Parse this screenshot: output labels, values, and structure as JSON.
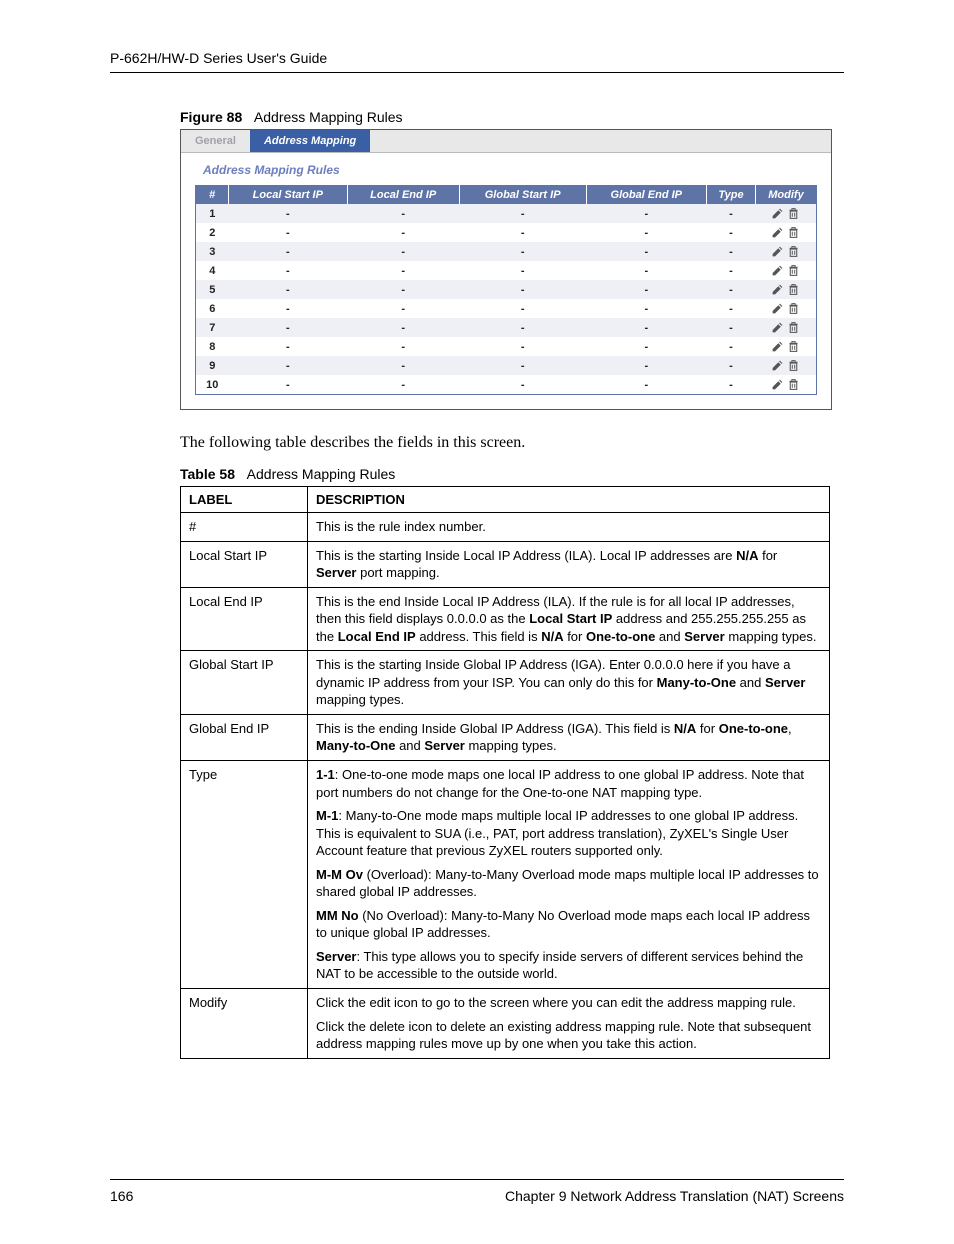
{
  "header_guide": "P-662H/HW-D Series User's Guide",
  "figure_caption_num": "Figure 88",
  "figure_caption_text": "Address Mapping Rules",
  "tabs": {
    "general": "General",
    "addrmap": "Address Mapping"
  },
  "panel_title": "Address Mapping Rules",
  "grid": {
    "headers": {
      "num": "#",
      "lstart": "Local Start IP",
      "lend": "Local End IP",
      "gstart": "Global Start IP",
      "gend": "Global End IP",
      "type": "Type",
      "modify": "Modify"
    },
    "rows": [
      {
        "n": "1",
        "ls": "-",
        "le": "-",
        "gs": "-",
        "ge": "-",
        "t": "-"
      },
      {
        "n": "2",
        "ls": "-",
        "le": "-",
        "gs": "-",
        "ge": "-",
        "t": "-"
      },
      {
        "n": "3",
        "ls": "-",
        "le": "-",
        "gs": "-",
        "ge": "-",
        "t": "-"
      },
      {
        "n": "4",
        "ls": "-",
        "le": "-",
        "gs": "-",
        "ge": "-",
        "t": "-"
      },
      {
        "n": "5",
        "ls": "-",
        "le": "-",
        "gs": "-",
        "ge": "-",
        "t": "-"
      },
      {
        "n": "6",
        "ls": "-",
        "le": "-",
        "gs": "-",
        "ge": "-",
        "t": "-"
      },
      {
        "n": "7",
        "ls": "-",
        "le": "-",
        "gs": "-",
        "ge": "-",
        "t": "-"
      },
      {
        "n": "8",
        "ls": "-",
        "le": "-",
        "gs": "-",
        "ge": "-",
        "t": "-"
      },
      {
        "n": "9",
        "ls": "-",
        "le": "-",
        "gs": "-",
        "ge": "-",
        "t": "-"
      },
      {
        "n": "10",
        "ls": "-",
        "le": "-",
        "gs": "-",
        "ge": "-",
        "t": "-"
      }
    ]
  },
  "intro_para": "The following table describes the fields in this screen.",
  "table_caption_num": "Table 58",
  "table_caption_text": "Address Mapping Rules",
  "desc_headers": {
    "label": "LABEL",
    "desc": "DESCRIPTION"
  },
  "desc": {
    "hash_l": "#",
    "hash_d": "This is the rule index number.",
    "lsip_l": "Local Start IP",
    "leip_l": "Local End IP",
    "gsip_l": "Global Start IP",
    "geip_l": "Global End IP",
    "type_l": "Type",
    "mod_l": "Modify"
  },
  "footer": {
    "page": "166",
    "chapter": "Chapter 9 Network Address Translation (NAT) Screens"
  }
}
